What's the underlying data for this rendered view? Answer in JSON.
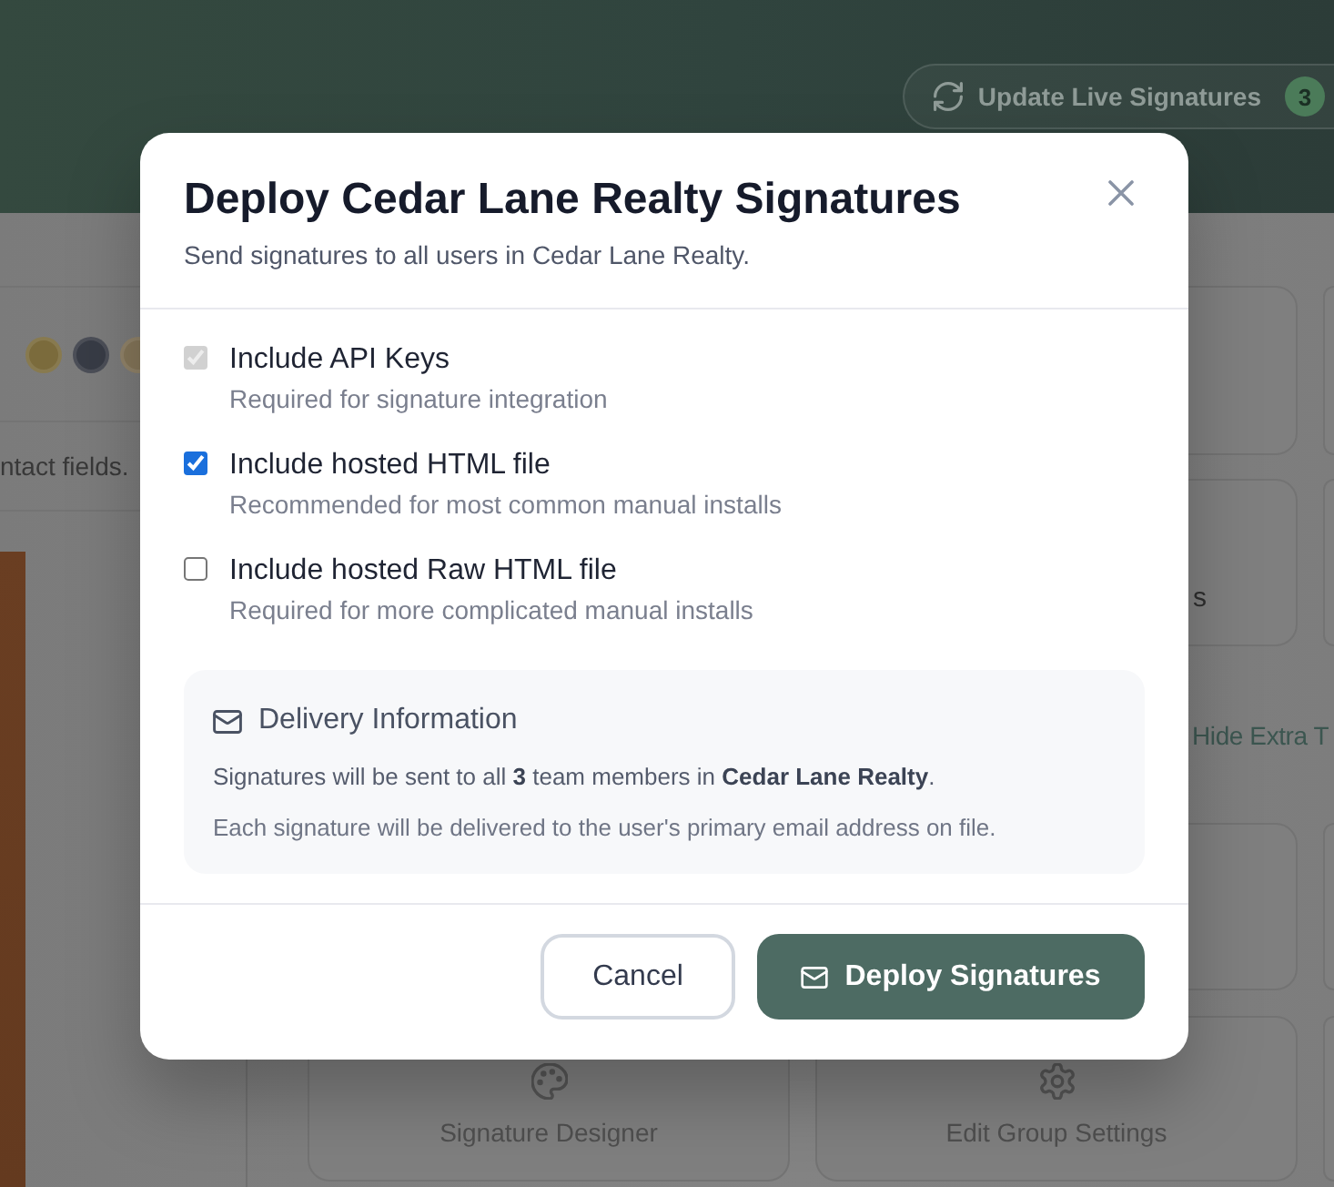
{
  "header": {
    "update_button": {
      "label": "Update Live Signatures",
      "badge": "3"
    }
  },
  "sidebar": {
    "swatches": [
      {
        "color": "#7b6b3c"
      },
      {
        "color": "#383c46"
      },
      {
        "color": "#86775a"
      }
    ],
    "hint": "ntact fields."
  },
  "main": {
    "card_label": "s",
    "toggle_link": "Hide Extra T",
    "action_cards": [
      {
        "label": "Signature Designer",
        "kind": "designer"
      },
      {
        "label": "Edit Group Settings",
        "kind": "settings"
      }
    ]
  },
  "dialog": {
    "title": "Deploy Cedar Lane Realty Signatures",
    "subtitle": "Send signatures to all users in Cedar Lane Realty.",
    "options": [
      {
        "label": "Include API Keys",
        "description": "Required for signature integration",
        "checked": true,
        "disabled": true
      },
      {
        "label": "Include hosted HTML file",
        "description": "Recommended for most common manual installs",
        "checked": true,
        "disabled": false
      },
      {
        "label": "Include hosted Raw HTML file",
        "description": "Required for more complicated manual installs",
        "checked": false,
        "disabled": false
      }
    ],
    "delivery": {
      "title": "Delivery Information",
      "lines": [
        "Signatures will be sent to all **3** team members in **Cedar Lane Realty**.",
        "Each signature will be delivered to the user's primary email address on file."
      ]
    },
    "buttons": [
      {
        "label": "Cancel",
        "kind": "secondary"
      },
      {
        "label": "Deploy Signatures",
        "kind": "primary"
      }
    ]
  }
}
